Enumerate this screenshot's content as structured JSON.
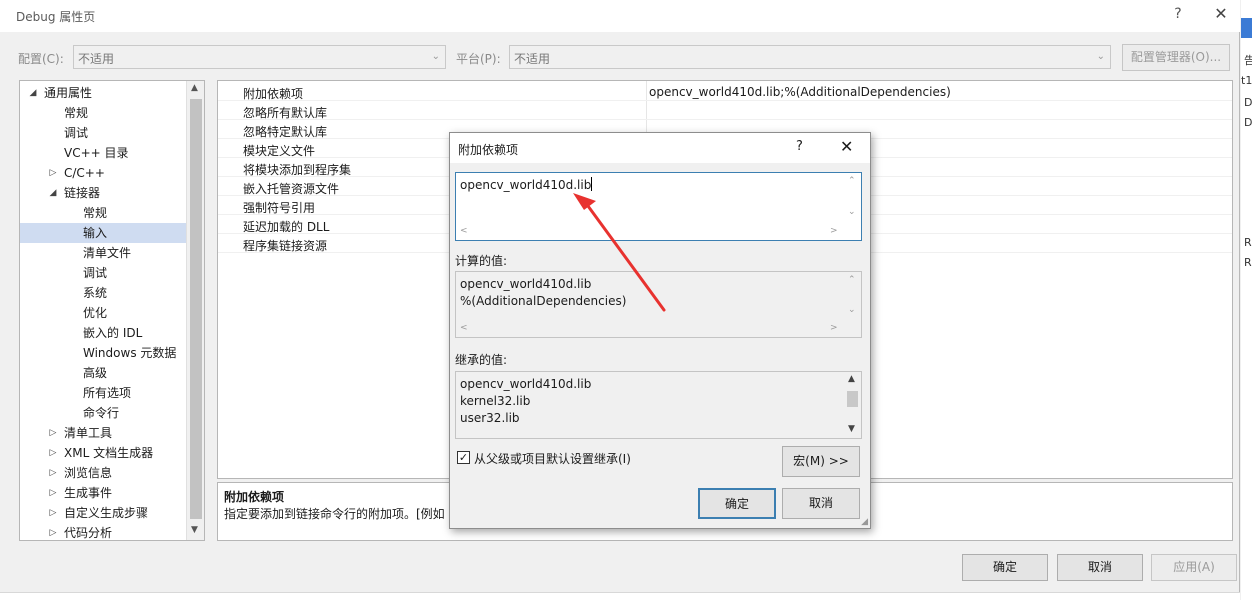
{
  "window": {
    "title": "Debug 属性页",
    "help": "?",
    "close": "✕"
  },
  "config": {
    "config_label": "配置(C):",
    "config_value": "不适用",
    "platform_label": "平台(P):",
    "platform_value": "不适用",
    "manager_button": "配置管理器(O)..."
  },
  "tree": {
    "items": [
      {
        "label": "通用属性",
        "toggle": "◢",
        "level": 0
      },
      {
        "label": "常规",
        "toggle": "",
        "level": 1
      },
      {
        "label": "调试",
        "toggle": "",
        "level": 1
      },
      {
        "label": "VC++ 目录",
        "toggle": "",
        "level": 1
      },
      {
        "label": "C/C++",
        "toggle": "▷",
        "level": 1
      },
      {
        "label": "链接器",
        "toggle": "◢",
        "level": 1
      },
      {
        "label": "常规",
        "toggle": "",
        "level": 2
      },
      {
        "label": "输入",
        "toggle": "",
        "level": 2,
        "selected": true
      },
      {
        "label": "清单文件",
        "toggle": "",
        "level": 2
      },
      {
        "label": "调试",
        "toggle": "",
        "level": 2
      },
      {
        "label": "系统",
        "toggle": "",
        "level": 2
      },
      {
        "label": "优化",
        "toggle": "",
        "level": 2
      },
      {
        "label": "嵌入的 IDL",
        "toggle": "",
        "level": 2
      },
      {
        "label": "Windows 元数据",
        "toggle": "",
        "level": 2
      },
      {
        "label": "高级",
        "toggle": "",
        "level": 2
      },
      {
        "label": "所有选项",
        "toggle": "",
        "level": 2
      },
      {
        "label": "命令行",
        "toggle": "",
        "level": 2
      },
      {
        "label": "清单工具",
        "toggle": "▷",
        "level": 1
      },
      {
        "label": "XML 文档生成器",
        "toggle": "▷",
        "level": 1
      },
      {
        "label": "浏览信息",
        "toggle": "▷",
        "level": 1
      },
      {
        "label": "生成事件",
        "toggle": "▷",
        "level": 1
      },
      {
        "label": "自定义生成步骤",
        "toggle": "▷",
        "level": 1
      },
      {
        "label": "代码分析",
        "toggle": "▷",
        "level": 1
      }
    ]
  },
  "properties": {
    "rows": [
      {
        "name": "附加依赖项",
        "value": "opencv_world410d.lib;%(AdditionalDependencies)"
      },
      {
        "name": "忽略所有默认库",
        "value": ""
      },
      {
        "name": "忽略特定默认库",
        "value": ""
      },
      {
        "name": "模块定义文件",
        "value": ""
      },
      {
        "name": "将模块添加到程序集",
        "value": ""
      },
      {
        "name": "嵌入托管资源文件",
        "value": ""
      },
      {
        "name": "强制符号引用",
        "value": ""
      },
      {
        "name": "延迟加载的 DLL",
        "value": ""
      },
      {
        "name": "程序集链接资源",
        "value": ""
      }
    ],
    "desc_title": "附加依赖项",
    "desc_text": "指定要添加到链接命令行的附加项。[例如"
  },
  "dialog": {
    "title": "附加依赖项",
    "help": "?",
    "close": "✕",
    "input_value": "opencv_world410d.lib",
    "computed_label": "计算的值:",
    "computed_lines": [
      "opencv_world410d.lib",
      "%(AdditionalDependencies)"
    ],
    "inherited_label": "继承的值:",
    "inherited_lines": [
      "opencv_world410d.lib",
      "kernel32.lib",
      "user32.lib"
    ],
    "inherit_checkbox": "从父级或项目默认设置继承(I)",
    "macro_button": "宏(M) >>",
    "ok_button": "确定",
    "cancel_button": "取消"
  },
  "footer": {
    "ok_button": "确定",
    "cancel_button": "取消",
    "apply_button": "应用(A)"
  },
  "background_edge": [
    "告",
    "t1",
    "D",
    "D",
    "R",
    "R"
  ],
  "colors": {
    "selection": "#cfdcf1",
    "focus_border": "#3c7fb1",
    "annotation_arrow": "#e8322f"
  }
}
